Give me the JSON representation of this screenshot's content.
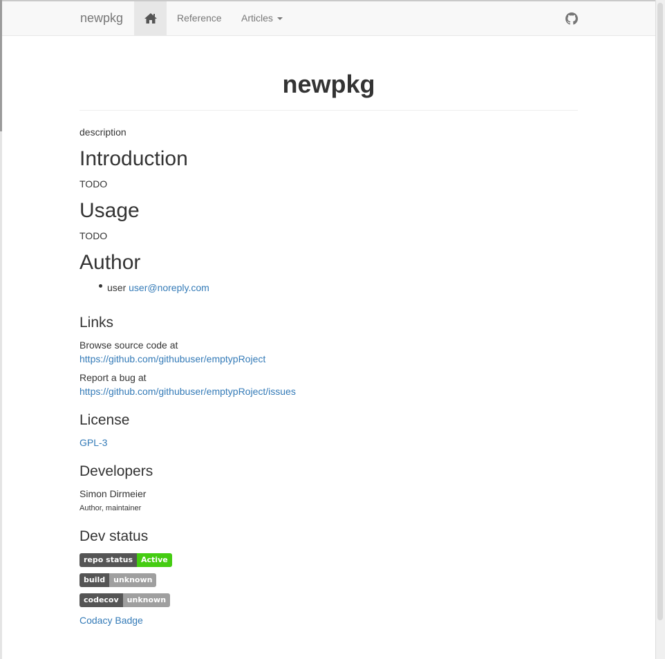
{
  "navbar": {
    "brand": "newpkg",
    "home_icon": "home-icon",
    "reference": "Reference",
    "articles": "Articles",
    "github_icon": "github-icon"
  },
  "page": {
    "title": "newpkg",
    "description": "description",
    "introduction": {
      "heading": "Introduction",
      "text": "TODO"
    },
    "usage": {
      "heading": "Usage",
      "text": "TODO"
    },
    "author": {
      "heading": "Author",
      "name": "user",
      "email": "user@noreply.com"
    }
  },
  "sidebar": {
    "links": {
      "heading": "Links",
      "browse_label": "Browse source code at",
      "browse_url": "https://github.com/githubuser/emptypRoject",
      "bug_label": "Report a bug at",
      "bug_url": "https://github.com/githubuser/emptypRoject/issues"
    },
    "license": {
      "heading": "License",
      "value": "GPL-3"
    },
    "developers": {
      "heading": "Developers",
      "name": "Simon Dirmeier",
      "role": "Author, maintainer"
    },
    "dev_status": {
      "heading": "Dev status",
      "badges": [
        {
          "left": "repo status",
          "right": "Active",
          "color": "#44cc11"
        },
        {
          "left": "build",
          "right": "unknown",
          "color": "#9f9f9f"
        },
        {
          "left": "codecov",
          "right": "unknown",
          "color": "#9f9f9f"
        }
      ],
      "codacy": "Codacy Badge"
    }
  },
  "colors": {
    "link": "#337ab7",
    "navbar_bg": "#f8f8f8",
    "active_nav": "#e7e7e7"
  }
}
